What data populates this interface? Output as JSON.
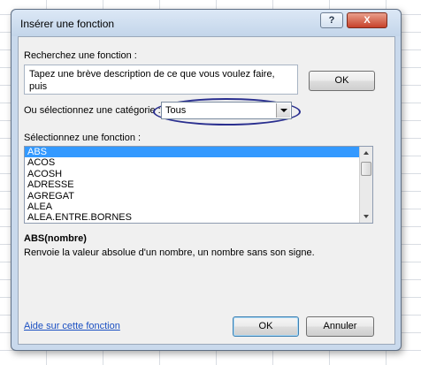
{
  "dialog": {
    "title": "Insérer une fonction",
    "help_label": "?",
    "close_label": "X"
  },
  "search": {
    "label": "Recherchez une fonction :",
    "text": "Tapez une brève description de ce que vous voulez faire, puis\ncliquez sur OK",
    "ok_label": "OK"
  },
  "category": {
    "label": "Ou sélectionnez une catégorie :",
    "selected": "Tous"
  },
  "functions": {
    "label": "Sélectionnez une fonction :",
    "items": [
      "ABS",
      "ACOS",
      "ACOSH",
      "ADRESSE",
      "AGREGAT",
      "ALEA",
      "ALEA.ENTRE.BORNES"
    ],
    "selected_index": 0
  },
  "details": {
    "signature": "ABS(nombre)",
    "description": "Renvoie la valeur absolue d'un nombre, un nombre sans son signe."
  },
  "footer": {
    "help_link": "Aide sur cette fonction",
    "ok_label": "OK",
    "cancel_label": "Annuler"
  },
  "colors": {
    "selection": "#3399ff",
    "highlight_oval": "#2a2f8f",
    "link": "#1a4fc2",
    "close_button": "#c7412a"
  }
}
